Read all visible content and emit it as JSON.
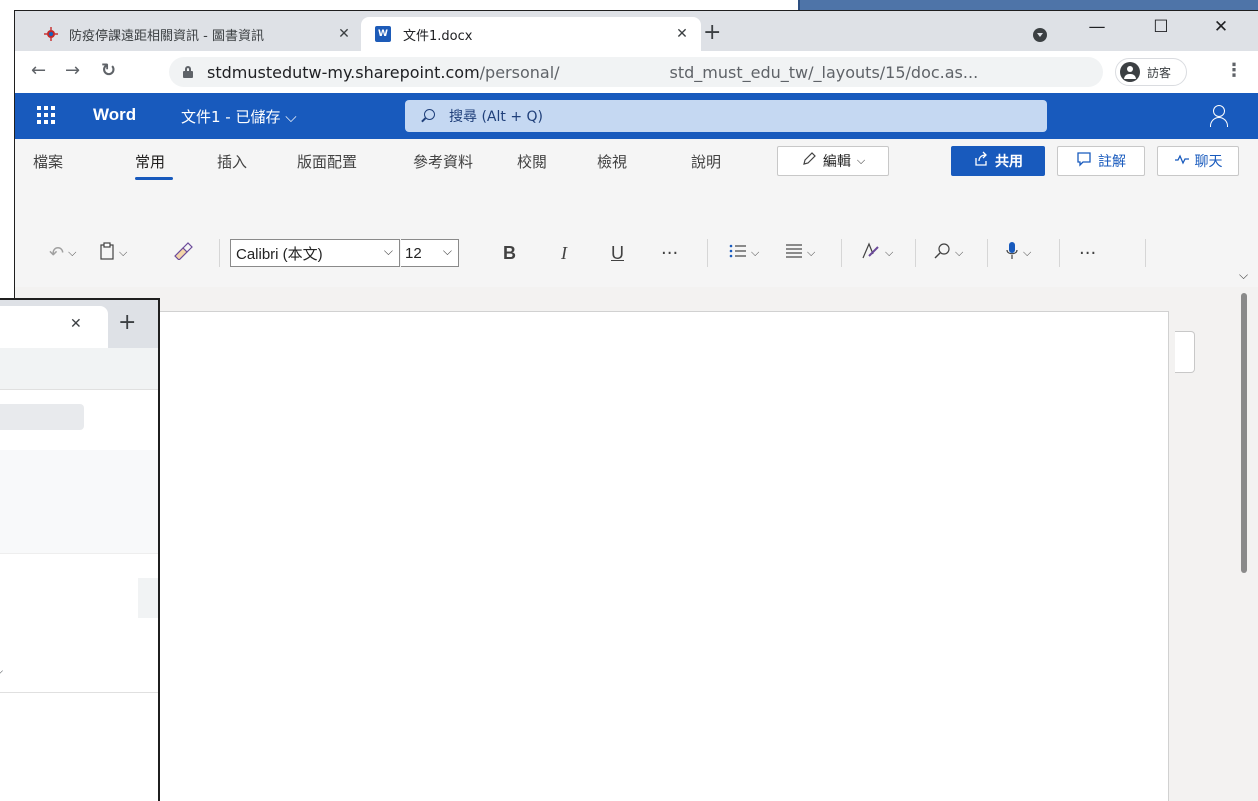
{
  "browser": {
    "tabs": [
      {
        "title": "防疫停課遠距相關資訊 - 圖書資訊",
        "active": false
      },
      {
        "title": "文件1.docx",
        "active": true
      }
    ],
    "new_tab_glyph": "+",
    "close_glyph": "✕",
    "window_controls": {
      "minimize": "—",
      "maximize": "☐",
      "close": "✕"
    },
    "url": {
      "host": "stdmustedutw-my.sharepoint.com",
      "path_start": "/personal/",
      "path_end": "std_must_edu_tw/_layouts/15/doc.as..."
    },
    "profile_label": "訪客"
  },
  "word": {
    "app_name": "Word",
    "doc_title": "文件1 - 已儲存 ⌵",
    "search_placeholder": "搜尋 (Alt + Q)",
    "ribbon_tabs": [
      "檔案",
      "常用",
      "插入",
      "版面配置",
      "參考資料",
      "校閱",
      "檢視",
      "說明"
    ],
    "active_tab": "常用",
    "edit_label": "編輯",
    "share_label": "共用",
    "comments_label": "註解",
    "chat_label": "聊天",
    "font_name": "Calibri (本文)",
    "font_size": "12",
    "bold": "B",
    "italic": "I",
    "underline": "U",
    "more": "···"
  },
  "second_window": {
    "close_glyph": "✕",
    "new_tab_glyph": "+"
  },
  "colors": {
    "word_blue": "#185abd",
    "chrome_tabstrip": "#dee1e6",
    "ribbon_bg": "#f5f5f5"
  }
}
